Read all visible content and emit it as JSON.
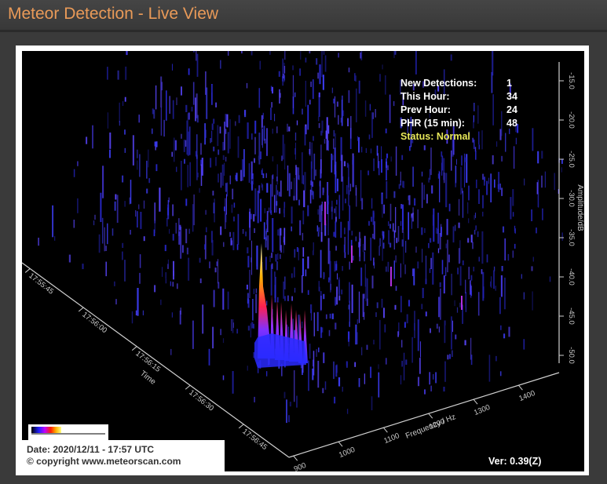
{
  "window": {
    "title": "Meteor Detection - Live View"
  },
  "stats": {
    "new_detections_label": "New Detections:",
    "new_detections": "1",
    "this_hour_label": "This Hour:",
    "this_hour": "34",
    "prev_hour_label": "Prev Hour:",
    "prev_hour": "24",
    "phr_label": "PHR (15 min):",
    "phr": "48",
    "status": "Status: Normal"
  },
  "caption": {
    "date": "Date: 2020/12/11 - 17:57 UTC",
    "copyright": "© copyright www.meteorscan.com"
  },
  "version": "Ver: 0.39(Z)",
  "axes": {
    "amplitude_title": "Amplitude/dB",
    "amplitude_ticks": [
      "-15.0",
      "-20.0",
      "-25.0",
      "-30.0",
      "-35.0",
      "-40.0",
      "-45.0",
      "-50.0"
    ],
    "time_title": "Time",
    "time_ticks": [
      "17:55:45",
      "17:56:00",
      "17:56:15",
      "17:56:30",
      "17:56:45"
    ],
    "freq_title": "Frequency / Hz",
    "freq_ticks": [
      "900",
      "1000",
      "1100",
      "1200",
      "1300",
      "1400"
    ]
  },
  "colors": {
    "title": "#e99a58",
    "status": "#e8e85a",
    "noise": "#3030d0",
    "peak": "#ffff80"
  }
}
